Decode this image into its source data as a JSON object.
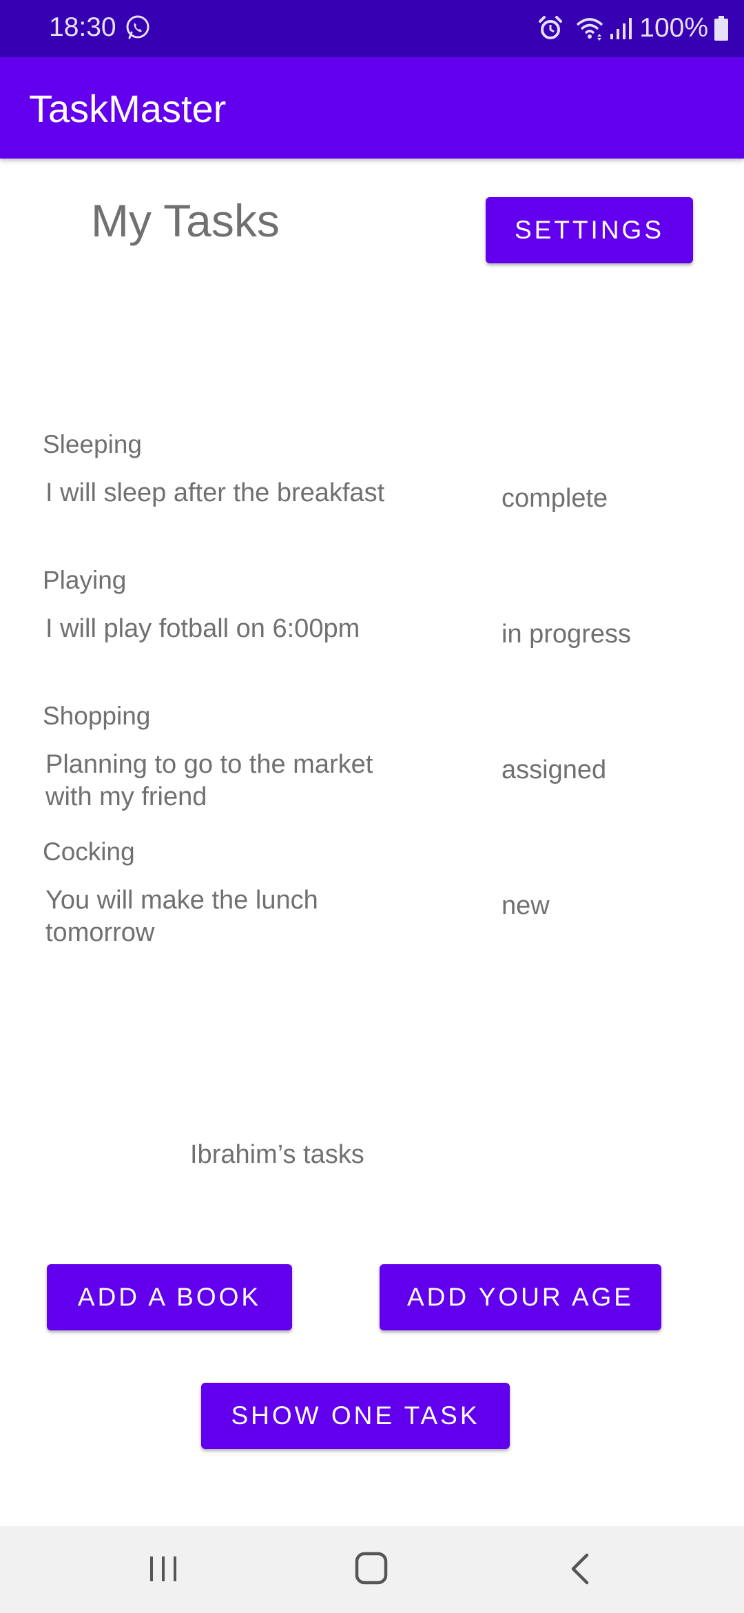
{
  "status_bar": {
    "time": "18:30",
    "battery": "100%"
  },
  "app_bar": {
    "title": "TaskMaster"
  },
  "header": {
    "title": "My Tasks",
    "settings_label": "SETTINGS"
  },
  "tasks": [
    {
      "title": "Sleeping",
      "body": "I will sleep after the breakfast",
      "state": "complete"
    },
    {
      "title": "Playing",
      "body": "I will play fotball on 6:00pm",
      "state": "in progress"
    },
    {
      "title": "Shopping",
      "body": "Planning to go to the market with my friend",
      "state": "assigned"
    },
    {
      "title": "Cocking",
      "body": "You will make the lunch tomorrow",
      "state": "new"
    }
  ],
  "owner_label": "Ibrahim’s tasks",
  "actions": {
    "add_book_label": "ADD A BOOK",
    "add_age_label": "ADD YOUR AGE",
    "show_one_task_label": "SHOW ONE TASK"
  },
  "colors": {
    "status_bar": "#3700b3",
    "primary": "#6200ee",
    "text": "#707070"
  },
  "icons": [
    "whatsapp-icon",
    "alarm-icon",
    "wifi-icon",
    "signal-icon",
    "battery-icon",
    "recents-icon",
    "home-icon",
    "back-icon"
  ]
}
